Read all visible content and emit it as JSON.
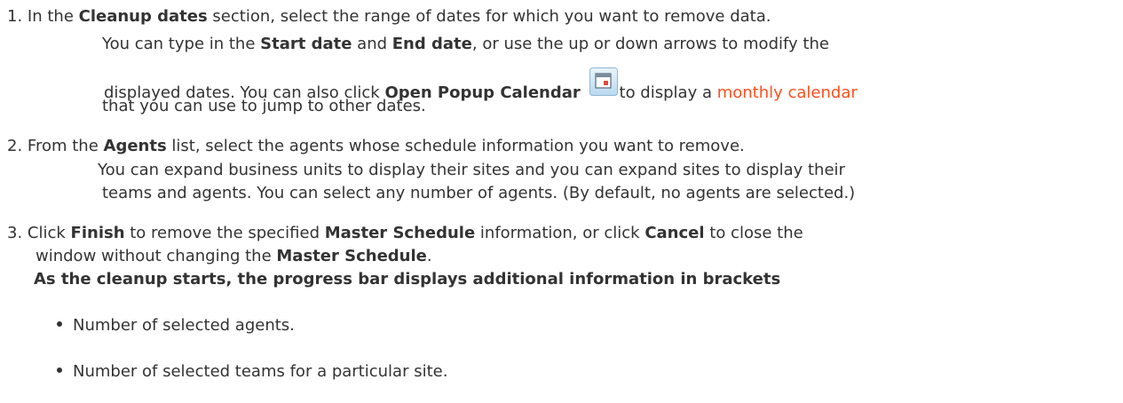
{
  "steps": [
    {
      "number": "1.",
      "lines": [
        [
          "In the ",
          "Cleanup dates",
          " section, select the range of dates for which you want to remove data."
        ],
        [
          "You can type in the ",
          "Start date",
          " and ",
          "End date",
          ", or use the up or down arrows to modify the"
        ],
        [
          "displayed dates. You can also click ",
          "Open Popup Calendar",
          " ",
          "to display a ",
          "monthly calendar"
        ],
        [
          "that you can use to jump to other dates."
        ]
      ],
      "icon": "calendar-icon"
    },
    {
      "number": "2.",
      "lines": [
        [
          "From the ",
          "Agents",
          " list, select the agents whose schedule information you want to remove."
        ],
        [
          "You can expand business units to display their sites and you can expand sites to display their"
        ],
        [
          "teams and agents. You can select any number of agents. (By default, no agents are selected.)"
        ]
      ]
    },
    {
      "number": "3.",
      "lines": [
        [
          "Click ",
          "Finish",
          " to remove the specified ",
          "Master Schedule",
          " information, or click ",
          "Cancel",
          " to close the"
        ],
        [
          "window without changing the ",
          "Master Schedule",
          "."
        ],
        [
          "As the cleanup starts, the progress bar displays additional information in brackets"
        ]
      ]
    }
  ],
  "bullets": [
    "Number of selected agents.",
    "Number of selected teams for a particular site."
  ],
  "colors": {
    "text": "#333333",
    "link": "#ff4f1f"
  }
}
